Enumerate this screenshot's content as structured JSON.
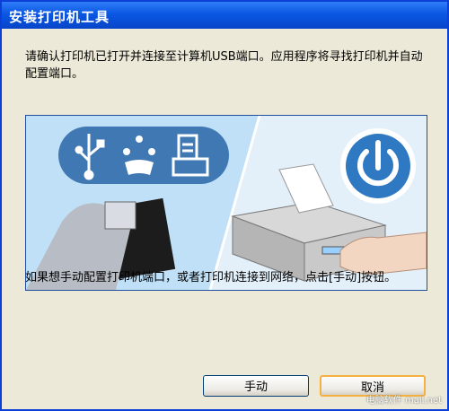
{
  "window": {
    "title": "安装打印机工具"
  },
  "instruction": "请确认打印机已打开并连接至计算机USB端口。应用程序将寻找打印机并自动配置端口。",
  "hint": "如果想手动配置打印机端口，或者打印机连接到网络，点击[手动]按钮。",
  "buttons": {
    "manual": "手动",
    "cancel": "取消"
  },
  "watermark": "电脑软件 mail.net",
  "illustration": {
    "port_icons": [
      "usb-icon",
      "firewire-icon",
      "printer-port-icon"
    ],
    "power_icon": "power-icon",
    "colors": {
      "sky": "#cfe6f8",
      "pill": "#3f78b3",
      "power": "#2f78c2"
    }
  }
}
